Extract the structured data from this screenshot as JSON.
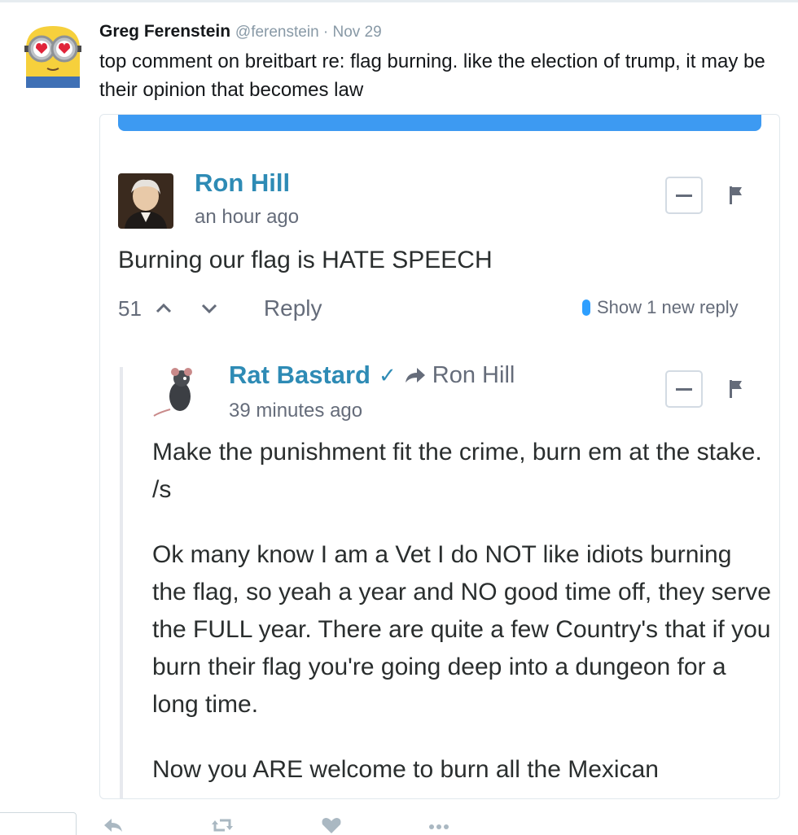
{
  "tweet": {
    "author_name": "Greg Ferenstein",
    "author_meta": "@ferenstein · Nov 29",
    "text": "top comment on breitbart re: flag burning. like the election of trump, it may be their opinion that becomes law"
  },
  "comment": {
    "author": "Ron Hill",
    "time": "an hour ago",
    "body": "Burning our flag is HATE SPEECH",
    "votes": "51",
    "reply_label": "Reply",
    "new_reply_label": "Show 1 new reply"
  },
  "reply": {
    "author": "Rat Bastard",
    "verified_mark": "✓",
    "in_reply_to": "Ron Hill",
    "time": "39 minutes ago",
    "paragraphs": [
      "Make the punishment fit the crime, burn em at the stake. /s",
      "Ok many know I am a Vet I do NOT like idiots burning the flag, so yeah a year and NO good time off, they serve the FULL year. There are quite a few Country's that if you burn their flag you're going deep into a dungeon for a long time.",
      "Now you ARE welcome to burn all the Mexican"
    ]
  },
  "icons": {
    "tweet_actions": [
      "reply-icon",
      "retweet-icon",
      "like-icon",
      "more-icon"
    ]
  },
  "colors": {
    "accent": "#3d9af2",
    "author_link": "#2e8bb5",
    "muted": "#656c7a",
    "new_reply_dot": "#2e9fff"
  }
}
